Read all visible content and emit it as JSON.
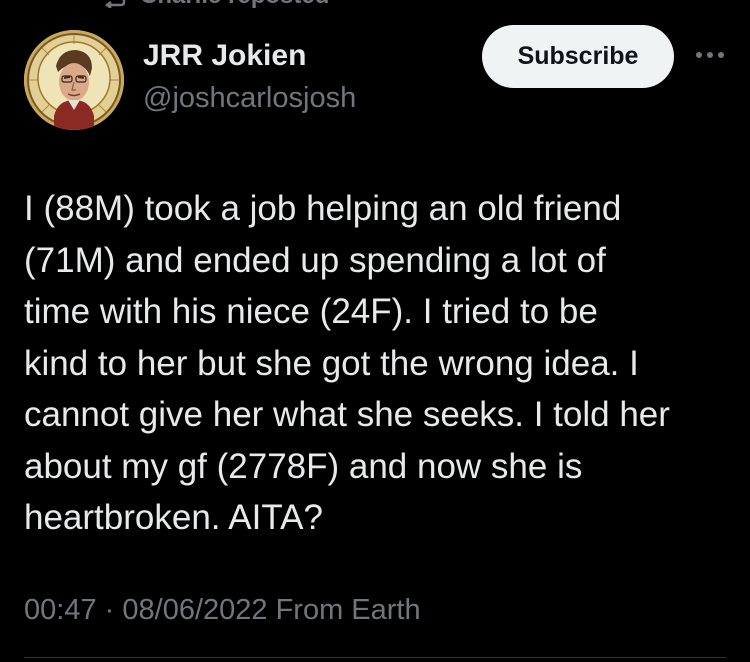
{
  "repost": {
    "label": "Charlie reposted",
    "icon": "repost-icon"
  },
  "author": {
    "display_name": "JRR Jokien",
    "handle": "@joshcarlosjosh",
    "avatar_icon": "portrait-avatar"
  },
  "actions": {
    "subscribe_label": "Subscribe",
    "more_icon": "more-options-icon"
  },
  "tweet": {
    "lines": [
      "I (88M) took a job helping an old friend",
      "(71M) and ended up spending a lot of",
      "time with his niece (24F). I tried to be",
      "kind to her but she got the wrong idea. I",
      "cannot give her what she seeks. I told her",
      "about my gf (2778F) and now she is",
      "heartbroken. AITA?"
    ]
  },
  "meta": {
    "time": "00:47",
    "date": "08/06/2022",
    "source": "From Earth",
    "separator": "·"
  },
  "colors": {
    "background": "#000000",
    "primary_text": "#e7e9ea",
    "secondary_text": "#71767b",
    "button_bg": "#eff3f4",
    "button_text": "#0f1419",
    "divider": "#2f3336"
  }
}
